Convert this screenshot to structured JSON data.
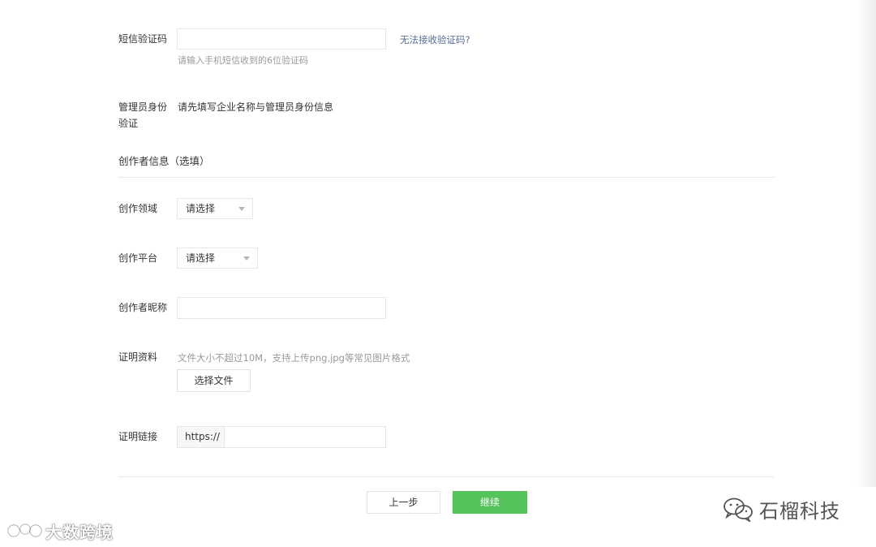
{
  "sms": {
    "label": "短信验证码",
    "value": "",
    "link": "无法接收验证码?",
    "hint": "请输入手机短信收到的6位验证码"
  },
  "admin": {
    "label_line1": "管理员身份",
    "label_line2": "验证",
    "text": "请先填写企业名称与管理员身份信息"
  },
  "creator_section": {
    "title": "创作者信息（选填）"
  },
  "field": {
    "label": "创作领域",
    "selected": "请选择"
  },
  "platform": {
    "label": "创作平台",
    "selected": "请选择"
  },
  "nickname": {
    "label": "创作者昵称",
    "value": ""
  },
  "proof": {
    "label": "证明资料",
    "hint": "文件大小不超过10M，支持上传png,jpg等常见图片格式",
    "button": "选择文件"
  },
  "proof_link": {
    "label": "证明链接",
    "prefix": "https://",
    "value": ""
  },
  "footer": {
    "prev_button": "上一步",
    "next_button": "继续"
  },
  "watermarks": {
    "left": "大数跨境",
    "right": "石榴科技"
  },
  "colors": {
    "accent_green": "#55c25c",
    "link_blue": "#576b95"
  }
}
